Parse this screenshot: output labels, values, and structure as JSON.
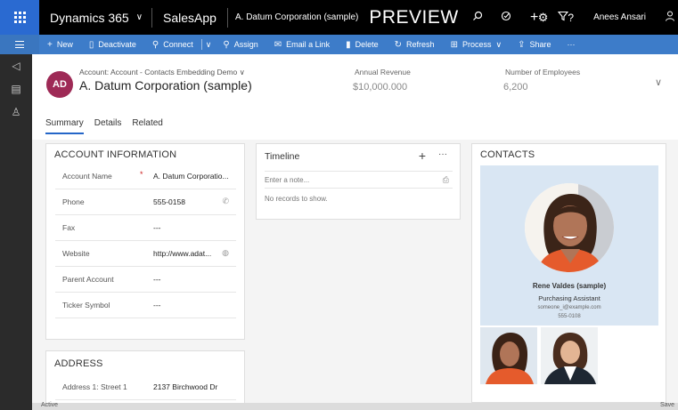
{
  "topbar": {
    "product": "Dynamics 365",
    "app": "SalesApp",
    "record": "A. Datum Corporation (sample)",
    "preview": "PREVIEW",
    "user": "Anees Ansari",
    "icons": [
      "search-icon",
      "task-icon",
      "plus-icon",
      "filter-icon",
      "gear-icon",
      "help-icon",
      "person-icon"
    ]
  },
  "commands": [
    {
      "label": "New",
      "icon": "+"
    },
    {
      "label": "Deactivate",
      "icon": "▯"
    },
    {
      "label": "Connect",
      "icon": "⚲"
    },
    {
      "label": "Assign",
      "icon": "⚲"
    },
    {
      "label": "Email a Link",
      "icon": "✉"
    },
    {
      "label": "Delete",
      "icon": "🗑"
    },
    {
      "label": "Refresh",
      "icon": "↻"
    },
    {
      "label": "Process",
      "icon": "⊞"
    },
    {
      "label": "Share",
      "icon": "⇪"
    },
    {
      "label": "···",
      "icon": ""
    }
  ],
  "header": {
    "avatar": "AD",
    "subtitle": "Account: Account - Contacts Embedding Demo",
    "title": "A. Datum Corporation (sample)",
    "fields": [
      {
        "label": "Annual Revenue",
        "value": "$10,000.000"
      },
      {
        "label": "Number of Employees",
        "value": "6,200"
      }
    ]
  },
  "tabs": [
    "Summary",
    "Details",
    "Related"
  ],
  "account_info": {
    "title": "ACCOUNT INFORMATION",
    "rows": [
      {
        "label": "Account Name",
        "value": "A. Datum Corporatio...",
        "required": "*"
      },
      {
        "label": "Phone",
        "value": "555-0158"
      },
      {
        "label": "Fax",
        "value": "---"
      },
      {
        "label": "Website",
        "value": "http://www.adat..."
      },
      {
        "label": "Parent Account",
        "value": "---"
      },
      {
        "label": "Ticker Symbol",
        "value": "---"
      }
    ]
  },
  "address": {
    "title": "ADDRESS",
    "rows": [
      {
        "label": "Address 1: Street 1",
        "value": "2137 Birchwood Dr"
      }
    ]
  },
  "timeline": {
    "title": "Timeline",
    "plus": "+",
    "more": "···",
    "placeholder": "Enter a note...",
    "empty": "No records to show."
  },
  "contacts": {
    "title": "CONTACTS",
    "primary": {
      "name": "Rene Valdes (sample)",
      "role": "Purchasing Assistant",
      "email": "someone_i@example.com",
      "phone": "555-0108"
    }
  },
  "statusbar": {
    "status": "Active",
    "save": "Save"
  },
  "colors": {
    "topbar": "#000000",
    "command_bar": "#3d7cc9",
    "accent": "#2566c8",
    "avatar": "#9e2a56",
    "contact_card": "#d9e6f3"
  }
}
